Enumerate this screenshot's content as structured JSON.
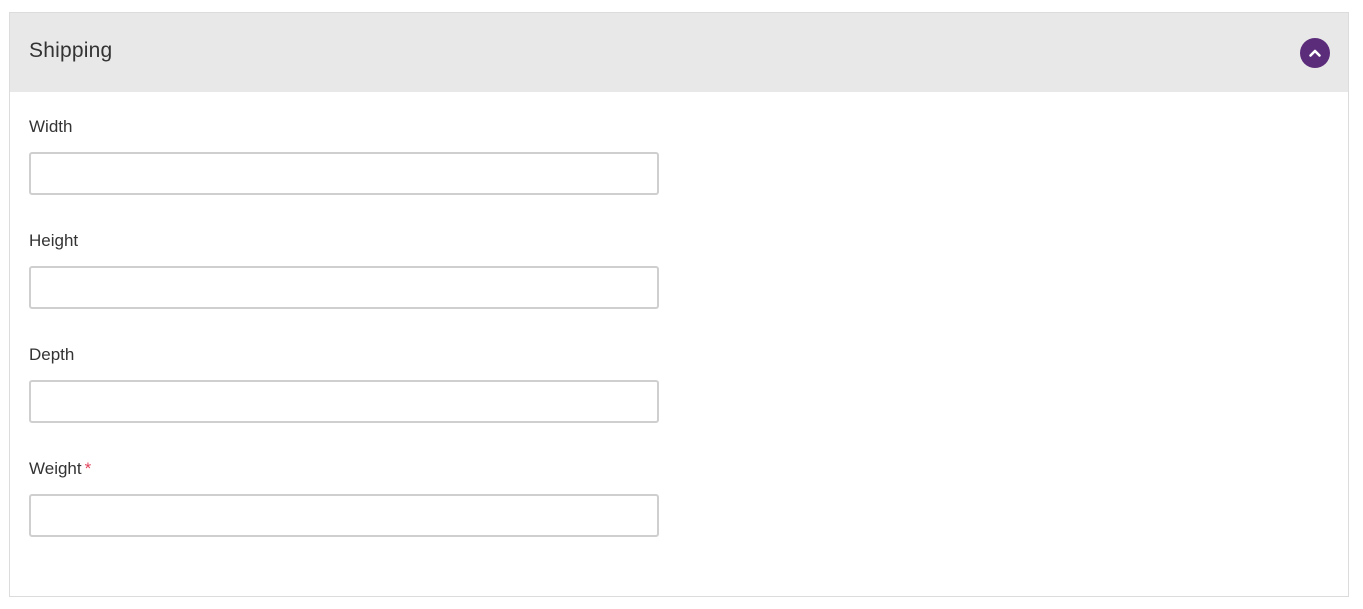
{
  "panel": {
    "title": "Shipping",
    "collapse_icon": "chevron-up-icon",
    "accent_color": "#5b2c7a",
    "required_color": "#e2445c"
  },
  "fields": {
    "width": {
      "label": "Width",
      "value": "",
      "placeholder": ""
    },
    "height": {
      "label": "Height",
      "value": "",
      "placeholder": ""
    },
    "depth": {
      "label": "Depth",
      "value": "",
      "placeholder": ""
    },
    "weight": {
      "label": "Weight",
      "required_mark": "*",
      "value": "",
      "placeholder": ""
    }
  }
}
